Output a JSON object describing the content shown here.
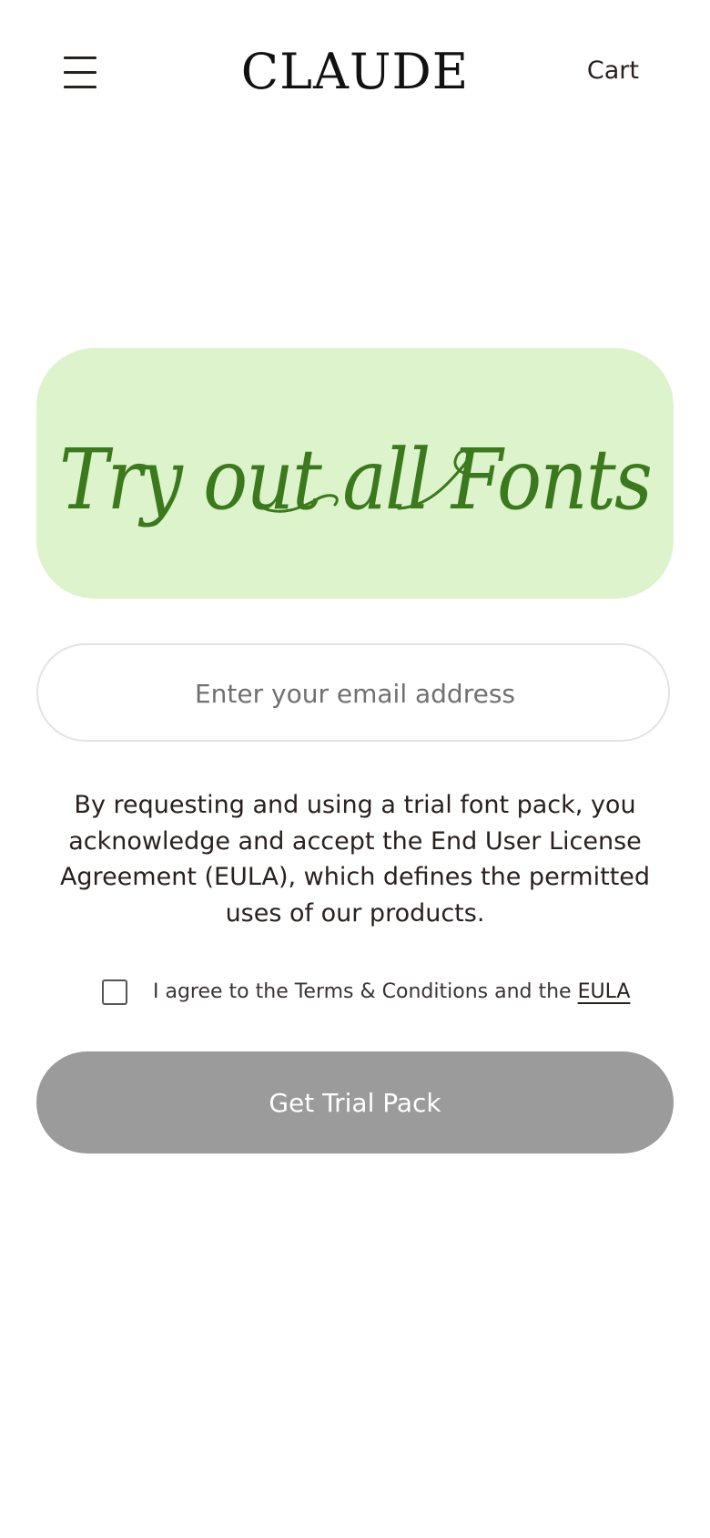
{
  "header": {
    "menu_icon": "hamburger-menu-icon",
    "logo_text": "CLAUDE",
    "cart_label": "Cart"
  },
  "banner": {
    "title": "Try out all Fonts",
    "background_color": "#dcf3cb",
    "text_color": "#3a7a1c"
  },
  "signup": {
    "email_placeholder": "Enter your email address",
    "email_value": "",
    "legal_text": "By requesting and using a trial font pack, you acknowledge and accept the End User License Agreement (EULA), which defines the permitted uses of our products.",
    "agree_prefix": "I agree to the Terms & Conditions and the ",
    "agree_link": "EULA",
    "agree_checked": false,
    "submit_label": "Get Trial Pack",
    "submit_color": "#9b9b9b"
  }
}
